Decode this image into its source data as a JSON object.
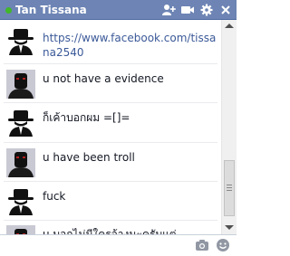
{
  "header": {
    "title": "Tan Tissana",
    "status_color": "#42b72a",
    "accent_color": "#6d84b4",
    "icons": [
      "add-friends-icon",
      "video-call-icon",
      "settings-gear-icon",
      "close-icon"
    ]
  },
  "messages": [
    {
      "text": "https://www.facebook.com/tissana2540",
      "kind": "link",
      "avatar": "hat-silhouette-avatar"
    },
    {
      "text": "u not have a evidence",
      "kind": "text",
      "avatar": "dark-face-avatar"
    },
    {
      "text": "ก็เค้าบอกผม =[]=",
      "kind": "text",
      "avatar": "hat-silhouette-avatar"
    },
    {
      "text": "u have been troll",
      "kind": "text",
      "avatar": "dark-face-avatar"
    },
    {
      "text": "fuck",
      "kind": "text",
      "avatar": "hat-silhouette-avatar"
    },
    {
      "text": "u บอกไม่มีใครจ้างนะครับแต่",
      "kind": "text",
      "avatar": "dark-face-avatar"
    }
  ],
  "footer": {
    "icons": [
      "camera-icon",
      "sticker-icon"
    ]
  }
}
